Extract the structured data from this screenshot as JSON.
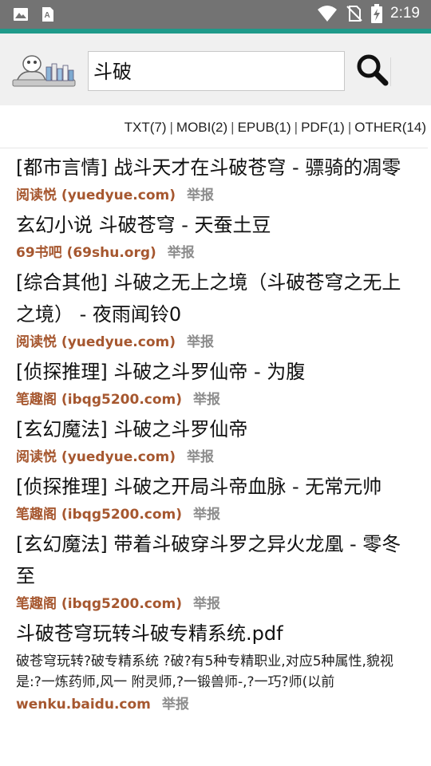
{
  "status": {
    "time": "2:19"
  },
  "search": {
    "query": "斗破"
  },
  "filters": [
    {
      "label": "TXT(7)"
    },
    {
      "label": "MOBI(2)"
    },
    {
      "label": "EPUB(1)"
    },
    {
      "label": "PDF(1)"
    },
    {
      "label": "OTHER(14)"
    }
  ],
  "results": [
    {
      "title": "[都市言情] 战斗天才在斗破苍穹 - 骠骑的凋零",
      "source": "阅读悦 (yuedyue.com)",
      "report": "举报"
    },
    {
      "title": "玄幻小说 斗破苍穹 - 天蚕土豆",
      "source": "69书吧 (69shu.org)",
      "report": "举报"
    },
    {
      "title": "[综合其他] 斗破之无上之境（斗破苍穹之无上之境） - 夜雨闻铃0",
      "source": "阅读悦 (yuedyue.com)",
      "report": "举报"
    },
    {
      "title": "[侦探推理] 斗破之斗罗仙帝 - 为腹",
      "source": "笔趣阁 (ibqg5200.com)",
      "report": "举报"
    },
    {
      "title": "[玄幻魔法] 斗破之斗罗仙帝",
      "source": "阅读悦 (yuedyue.com)",
      "report": "举报"
    },
    {
      "title": "[侦探推理] 斗破之开局斗帝血脉 - 无常元帅",
      "source": "笔趣阁 (ibqg5200.com)",
      "report": "举报"
    },
    {
      "title": "[玄幻魔法] 带着斗破穿斗罗之异火龙凰 - 零冬至",
      "source": "笔趣阁 (ibqg5200.com)",
      "report": "举报"
    },
    {
      "title": "斗破苍穹玩转斗破专精系统.pdf",
      "snippet": "破苍穹玩转?破专精系统 ?破?有5种专精职业,对应5种属性,貌视是:?一炼药师,风一 附灵师,?一锻兽师-,?一巧?师(以前",
      "source": "wenku.baidu.com",
      "report": "举报"
    }
  ]
}
